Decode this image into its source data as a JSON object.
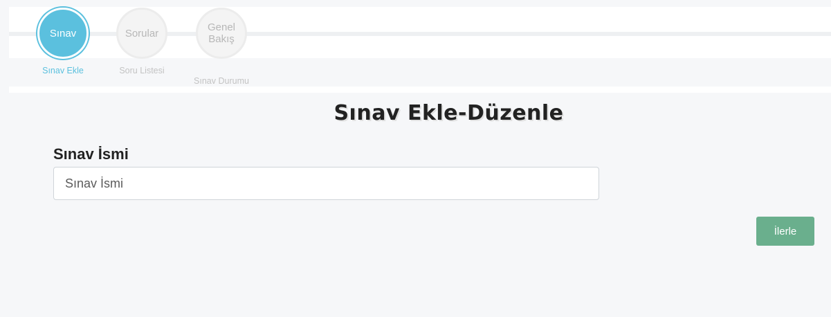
{
  "stepper": {
    "steps": [
      {
        "circle_text": "Sınav",
        "label": "Sınav Ekle",
        "state": "active"
      },
      {
        "circle_text": "Sorular",
        "label": "Soru Listesi",
        "state": "inactive"
      },
      {
        "circle_text": "Genel Bakış",
        "label": "Sınav Durumu",
        "state": "inactive"
      }
    ]
  },
  "page": {
    "title": "Sınav Ekle-Düzenle"
  },
  "form": {
    "exam_name_label": "Sınav İsmi",
    "exam_name_placeholder": "Sınav İsmi",
    "exam_name_value": "",
    "next_button_label": "İlerle"
  },
  "colors": {
    "active_step": "#5bc0de",
    "inactive_step_text": "#b7b7b7",
    "next_button": "#6aaf8d"
  }
}
